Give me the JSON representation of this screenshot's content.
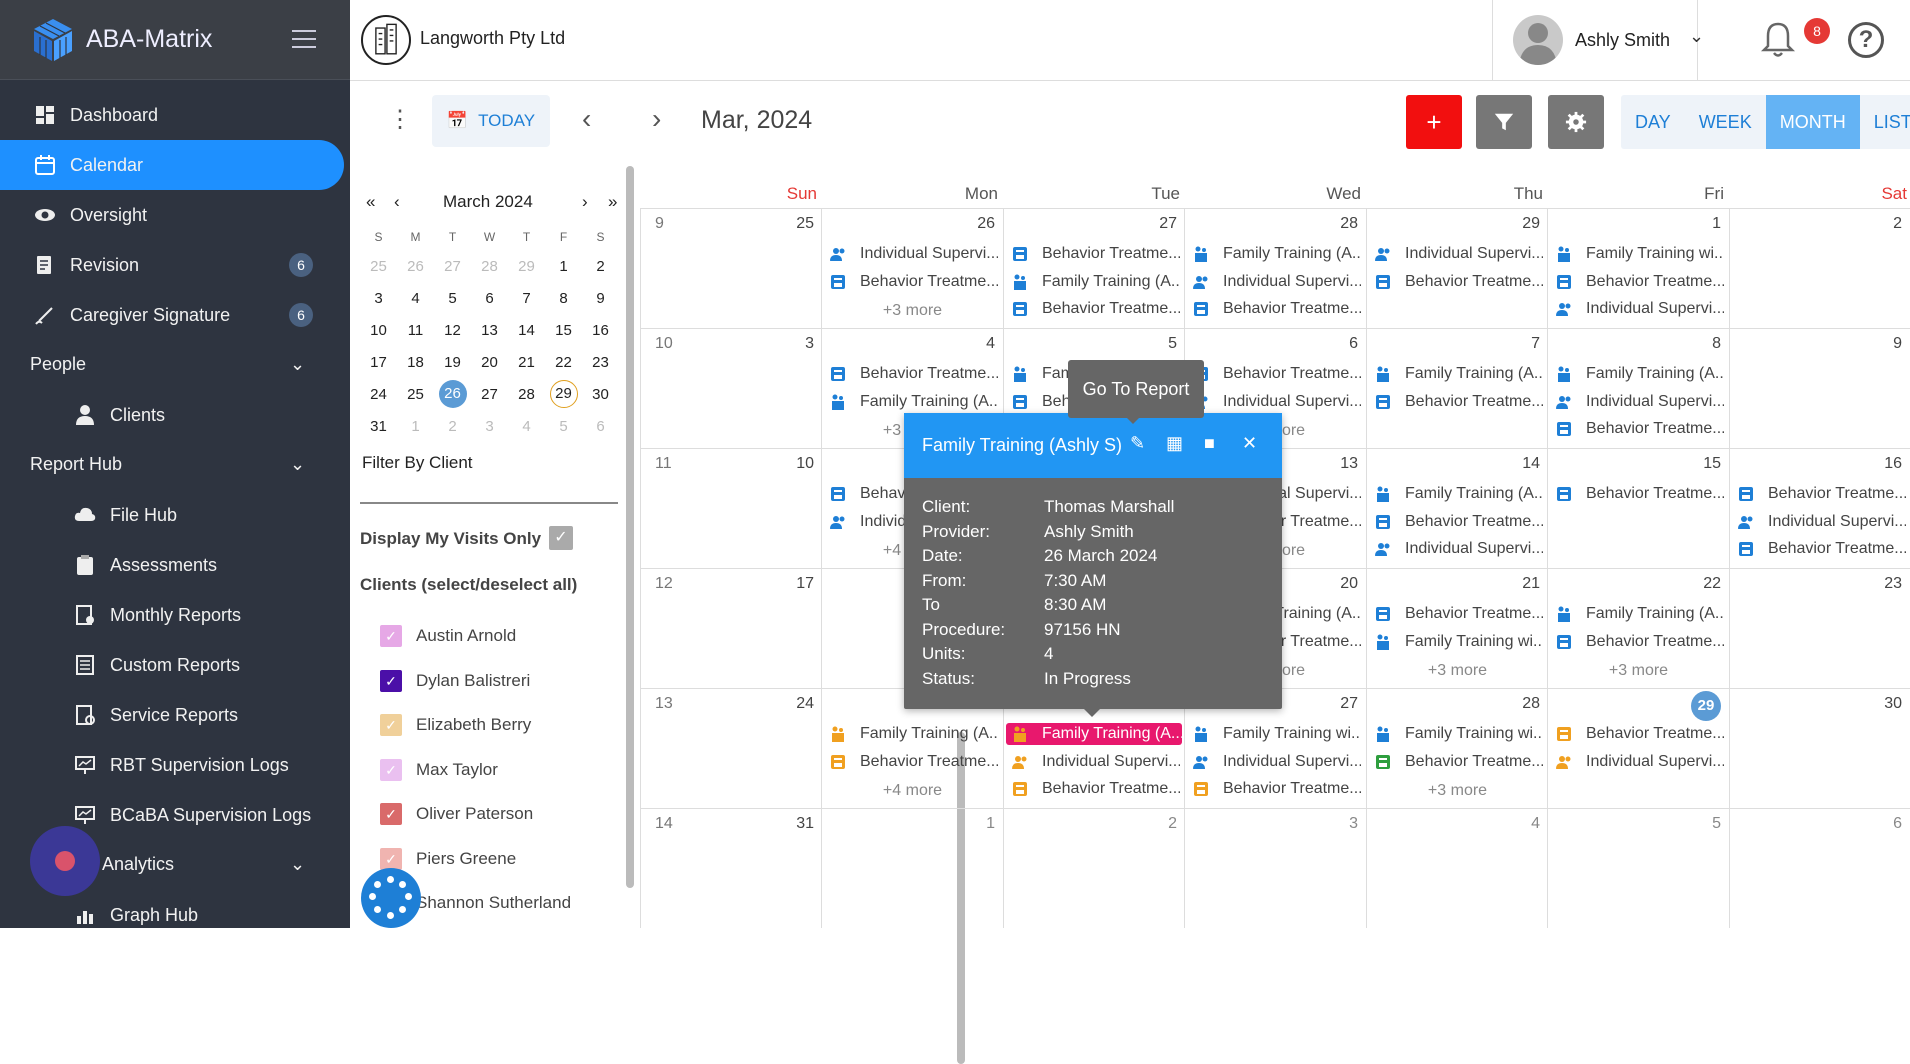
{
  "brand": {
    "name": "ABA-Matrix"
  },
  "sidebar": {
    "items": [
      {
        "label": "Dashboard"
      },
      {
        "label": "Calendar"
      },
      {
        "label": "Oversight"
      },
      {
        "label": "Revision",
        "badge": "6"
      },
      {
        "label": "Caregiver Signature",
        "badge": "6"
      }
    ],
    "people": {
      "label": "People",
      "items": [
        {
          "label": "Clients"
        }
      ]
    },
    "report_hub": {
      "label": "Report Hub",
      "items": [
        {
          "label": "File Hub"
        },
        {
          "label": "Assessments"
        },
        {
          "label": "Monthly Reports"
        },
        {
          "label": "Custom Reports"
        },
        {
          "label": "Service Reports"
        },
        {
          "label": "RBT Supervision Logs"
        },
        {
          "label": "BCaBA Supervision Logs"
        }
      ]
    },
    "analytics": {
      "label": "Analytics",
      "items": [
        {
          "label": "Graph Hub"
        }
      ]
    }
  },
  "header": {
    "company": "Langworth Pty Ltd",
    "user": "Ashly Smith",
    "notifications": "8",
    "help": "?"
  },
  "toolbar": {
    "today": "TODAY",
    "month_title": "Mar, 2024",
    "add": "+",
    "views": [
      "DAY",
      "WEEK",
      "MONTH",
      "LIST"
    ],
    "active_view": "MONTH"
  },
  "mini_calendar": {
    "title": "March 2024",
    "weekdays": [
      "S",
      "M",
      "T",
      "W",
      "T",
      "F",
      "S"
    ],
    "weeks": [
      [
        "25",
        "26",
        "27",
        "28",
        "29",
        "1",
        "2"
      ],
      [
        "3",
        "4",
        "5",
        "6",
        "7",
        "8",
        "9"
      ],
      [
        "10",
        "11",
        "12",
        "13",
        "14",
        "15",
        "16"
      ],
      [
        "17",
        "18",
        "19",
        "20",
        "21",
        "22",
        "23"
      ],
      [
        "24",
        "25",
        "26",
        "27",
        "28",
        "29",
        "30"
      ],
      [
        "31",
        "1",
        "2",
        "3",
        "4",
        "5",
        "6"
      ]
    ],
    "selected": "26",
    "today": "29"
  },
  "filters": {
    "filter_by_client": "Filter By Client",
    "display_my_visits": "Display My Visits Only",
    "clients_header": "Clients (select/deselect all)",
    "clients": [
      {
        "name": "Austin Arnold",
        "color": "#e6a8e6",
        "checked": true
      },
      {
        "name": "Dylan Balistreri",
        "color": "#4b0fa8",
        "checked": true
      },
      {
        "name": "Elizabeth Berry",
        "color": "#f0d09a",
        "checked": true
      },
      {
        "name": "Max Taylor",
        "color": "#eac0f0",
        "checked": true
      },
      {
        "name": "Oliver Paterson",
        "color": "#d96a6a",
        "checked": true
      },
      {
        "name": "Piers Greene",
        "color": "#f0b4b0",
        "checked": true
      },
      {
        "name": "Shannon Sutherland",
        "color": "#1e7fd6",
        "checked": true
      }
    ]
  },
  "calendar": {
    "weekdays": [
      "Sun",
      "Mon",
      "Tue",
      "Wed",
      "Thu",
      "Fri",
      "Sat"
    ],
    "weeks": [
      {
        "num": "9",
        "days": [
          {
            "d": "25",
            "ev": []
          },
          {
            "d": "26",
            "ev": [
              [
                "Individual Supervi...",
                "person",
                "#1e7fd6"
              ],
              [
                "Behavior Treatme...",
                "book",
                "#1e7fd6"
              ]
            ],
            "more": "+3 more"
          },
          {
            "d": "27",
            "ev": [
              [
                "Behavior Treatme...",
                "book",
                "#1e7fd6"
              ],
              [
                "Family Training (A...",
                "family",
                "#1e7fd6"
              ],
              [
                "Behavior Treatme...",
                "book",
                "#1e7fd6"
              ]
            ]
          },
          {
            "d": "28",
            "ev": [
              [
                "Family Training (A...",
                "family",
                "#1e7fd6"
              ],
              [
                "Individual Supervi...",
                "person",
                "#1e7fd6"
              ],
              [
                "Behavior Treatme...",
                "book",
                "#1e7fd6"
              ]
            ]
          },
          {
            "d": "29",
            "ev": [
              [
                "Individual Supervi...",
                "person",
                "#1e7fd6"
              ],
              [
                "Behavior Treatme...",
                "book",
                "#1e7fd6"
              ]
            ]
          },
          {
            "d": "1",
            "ev": [
              [
                "Family Training wi...",
                "family",
                "#1e7fd6"
              ],
              [
                "Behavior Treatme...",
                "book",
                "#1e7fd6"
              ],
              [
                "Individual Supervi...",
                "person",
                "#1e7fd6"
              ]
            ]
          },
          {
            "d": "2",
            "ev": []
          }
        ]
      },
      {
        "num": "10",
        "days": [
          {
            "d": "3",
            "ev": []
          },
          {
            "d": "4",
            "ev": [
              [
                "Behavior Treatme...",
                "book",
                "#1e7fd6"
              ],
              [
                "Family Training (A...",
                "family",
                "#1e7fd6"
              ]
            ],
            "more": "+3 more"
          },
          {
            "d": "5",
            "ev": [
              [
                "Family Training (A...",
                "family",
                "#1e7fd6"
              ],
              [
                "Behavior Treatme...",
                "book",
                "#1e7fd6"
              ]
            ]
          },
          {
            "d": "6",
            "ev": [
              [
                "Behavior Treatme...",
                "book",
                "#1e7fd6"
              ],
              [
                "Individual Supervi...",
                "person",
                "#1e7fd6"
              ]
            ],
            "more": "+3 more"
          },
          {
            "d": "7",
            "ev": [
              [
                "Family Training (A...",
                "family",
                "#1e7fd6"
              ],
              [
                "Behavior Treatme...",
                "book",
                "#1e7fd6"
              ]
            ]
          },
          {
            "d": "8",
            "ev": [
              [
                "Family Training (A...",
                "family",
                "#1e7fd6"
              ],
              [
                "Individual Supervi...",
                "person",
                "#1e7fd6"
              ],
              [
                "Behavior Treatme...",
                "book",
                "#1e7fd6"
              ]
            ]
          },
          {
            "d": "9",
            "ev": []
          }
        ]
      },
      {
        "num": "11",
        "days": [
          {
            "d": "10",
            "ev": []
          },
          {
            "d": "11",
            "ev": [
              [
                "Behavior Treatme...",
                "book",
                "#1e7fd6"
              ],
              [
                "Individual Supervi...",
                "person",
                "#1e7fd6"
              ]
            ],
            "more": "+4 more"
          },
          {
            "d": "12",
            "ev": []
          },
          {
            "d": "13",
            "ev": [
              [
                "Individual Supervi...",
                "person",
                "#1e7fd6"
              ],
              [
                "Behavior Treatme...",
                "book",
                "#1e7fd6"
              ]
            ],
            "more": "+3 more"
          },
          {
            "d": "14",
            "ev": [
              [
                "Family Training (A...",
                "family",
                "#1e7fd6"
              ],
              [
                "Behavior Treatme...",
                "book",
                "#1e7fd6"
              ],
              [
                "Individual Supervi...",
                "person",
                "#1e7fd6"
              ]
            ]
          },
          {
            "d": "15",
            "ev": [
              [
                "Behavior Treatme...",
                "book",
                "#1e7fd6"
              ]
            ]
          },
          {
            "d": "16",
            "ev": [
              [
                "Behavior Treatme...",
                "book",
                "#1e7fd6"
              ],
              [
                "Individual Supervi...",
                "person",
                "#1e7fd6"
              ],
              [
                "Behavior Treatme...",
                "book",
                "#1e7fd6"
              ]
            ]
          }
        ]
      },
      {
        "num": "12",
        "days": [
          {
            "d": "17",
            "ev": []
          },
          {
            "d": "18",
            "ev": []
          },
          {
            "d": "19",
            "ev": []
          },
          {
            "d": "20",
            "ev": [
              [
                "Family Training (A...",
                "family",
                "#1e7fd6"
              ],
              [
                "Behavior Treatme...",
                "book",
                "#1e7fd6"
              ]
            ],
            "more": "+3 more"
          },
          {
            "d": "21",
            "ev": [
              [
                "Behavior Treatme...",
                "book",
                "#1e7fd6"
              ],
              [
                "Family Training wi...",
                "family",
                "#1e7fd6"
              ]
            ],
            "more": "+3 more"
          },
          {
            "d": "22",
            "ev": [
              [
                "Family Training (A...",
                "family",
                "#1e7fd6"
              ],
              [
                "Behavior Treatme...",
                "book",
                "#1e7fd6"
              ]
            ],
            "more": "+3 more"
          },
          {
            "d": "23",
            "ev": []
          }
        ]
      },
      {
        "num": "13",
        "days": [
          {
            "d": "24",
            "ev": []
          },
          {
            "d": "25",
            "ev": [
              [
                "Family Training (A...",
                "family",
                "#f0a020"
              ],
              [
                "Behavior Treatme...",
                "book",
                "#f0a020"
              ]
            ],
            "more": "+4 more"
          },
          {
            "d": "26",
            "ev": [
              [
                "Family Training (A...",
                "family",
                "#f0a020",
                "hl"
              ],
              [
                "Individual Supervi...",
                "person",
                "#f0a020"
              ],
              [
                "Behavior Treatme...",
                "book",
                "#f0a020"
              ]
            ]
          },
          {
            "d": "27",
            "ev": [
              [
                "Family Training wi...",
                "family",
                "#1e7fd6"
              ],
              [
                "Individual Supervi...",
                "person",
                "#1e7fd6"
              ],
              [
                "Behavior Treatme...",
                "book",
                "#f0a020"
              ]
            ]
          },
          {
            "d": "28",
            "ev": [
              [
                "Family Training wi...",
                "family",
                "#1e7fd6"
              ],
              [
                "Behavior Treatme...",
                "book",
                "#2e9e3e"
              ]
            ],
            "more": "+3 more"
          },
          {
            "d": "29",
            "ev": [
              [
                "Behavior Treatme...",
                "book",
                "#f0a020"
              ],
              [
                "Individual Supervi...",
                "person",
                "#f0a020"
              ]
            ],
            "today": true
          },
          {
            "d": "30",
            "ev": []
          }
        ]
      },
      {
        "num": "14",
        "days": [
          {
            "d": "31",
            "ev": []
          },
          {
            "d": "1",
            "ev": [],
            "dim": true
          },
          {
            "d": "2",
            "ev": [],
            "dim": true
          },
          {
            "d": "3",
            "ev": [],
            "dim": true
          },
          {
            "d": "4",
            "ev": [],
            "dim": true
          },
          {
            "d": "5",
            "ev": [],
            "dim": true
          },
          {
            "d": "6",
            "ev": [],
            "dim": true
          }
        ]
      }
    ]
  },
  "popup": {
    "title": "Family Training (Ashly S)",
    "fields": [
      {
        "k": "Client:",
        "v": "Thomas Marshall"
      },
      {
        "k": "Provider:",
        "v": "Ashly Smith"
      },
      {
        "k": "Date:",
        "v": "26 March 2024"
      },
      {
        "k": "From:",
        "v": "7:30 AM"
      },
      {
        "k": "To",
        "v": "8:30 AM"
      },
      {
        "k": "Procedure:",
        "v": "97156 HN"
      },
      {
        "k": "Units:",
        "v": "4"
      },
      {
        "k": "Status:",
        "v": "In Progress"
      }
    ]
  },
  "tooltip": {
    "text": "Go To Report"
  },
  "colors": {
    "accent": "#1e90ff",
    "sidebar": "#2e3440",
    "sunday": "#e53935",
    "add": "#f20f0f"
  }
}
